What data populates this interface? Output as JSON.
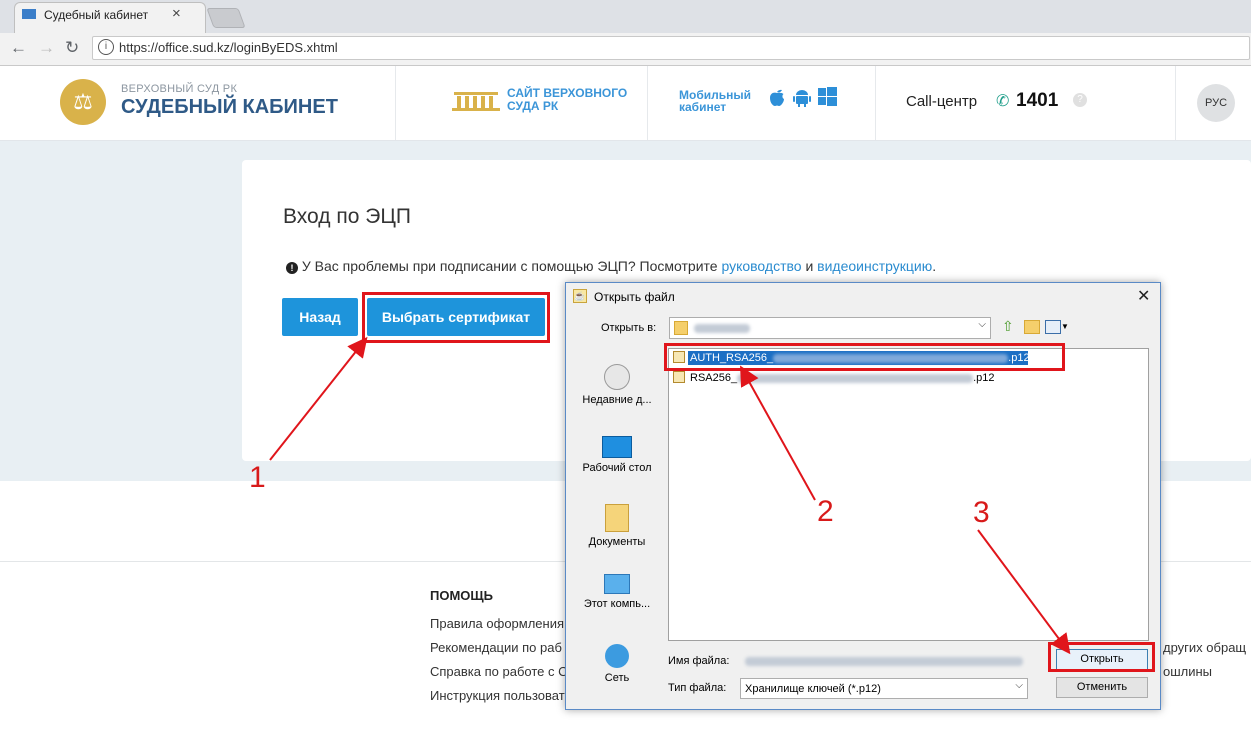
{
  "browser": {
    "tab_title": "Судебный кабинет",
    "url": "https://office.sud.kz/loginByEDS.xhtml"
  },
  "header": {
    "brand_sub": "ВЕРХОВНЫЙ СУД РК",
    "brand_main": "СУДЕБНЫЙ КАБИНЕТ",
    "court_link_1": "САЙТ ВЕРХОВНОГО",
    "court_link_2": "СУДА РК",
    "mobile_1": "Мобильный",
    "mobile_2": "кабинет",
    "call_label": "Call-центр",
    "call_number": "1401",
    "language": "РУС"
  },
  "main": {
    "title": "Вход по ЭЦП",
    "hint_text": " У Вас проблемы при подписании с помощью ЭЦП? Посмотрите ",
    "hint_link1": "руководство",
    "hint_and": " и ",
    "hint_link2": "видеоинструкцию",
    "hint_end": ".",
    "back_button": "Назад",
    "cert_button": "Выбрать сертификат"
  },
  "footer": {
    "help_title": "ПОМОЩЬ",
    "links": [
      "Правила оформления",
      "Рекомендации по раб",
      "Справка по работе с С",
      "Инструкция пользоват"
    ],
    "right_1": "других обращ",
    "right_2": "ошлины"
  },
  "dialog": {
    "title": "Открыть файл",
    "look_in_label": "Открыть в:",
    "places": [
      "Недавние д...",
      "Рабочий стол",
      "Документы",
      "Этот компь...",
      "Сеть"
    ],
    "files": [
      {
        "prefix": "AUTH_RSA256_",
        "suffix": ".p12",
        "selected": true
      },
      {
        "prefix": "RSA256_",
        "suffix": ".p12",
        "selected": false
      }
    ],
    "filename_label": "Имя файла:",
    "filetype_label": "Тип файла:",
    "filetype_value": "Хранилище ключей (*.p12)",
    "open_button": "Открыть",
    "cancel_button": "Отменить"
  },
  "annotations": {
    "step1": "1",
    "step2": "2",
    "step3": "3",
    "color": "#e0151b"
  },
  "colors": {
    "accent": "#1e94db",
    "brand": "#2f5a87",
    "link": "#2a8bcf"
  }
}
